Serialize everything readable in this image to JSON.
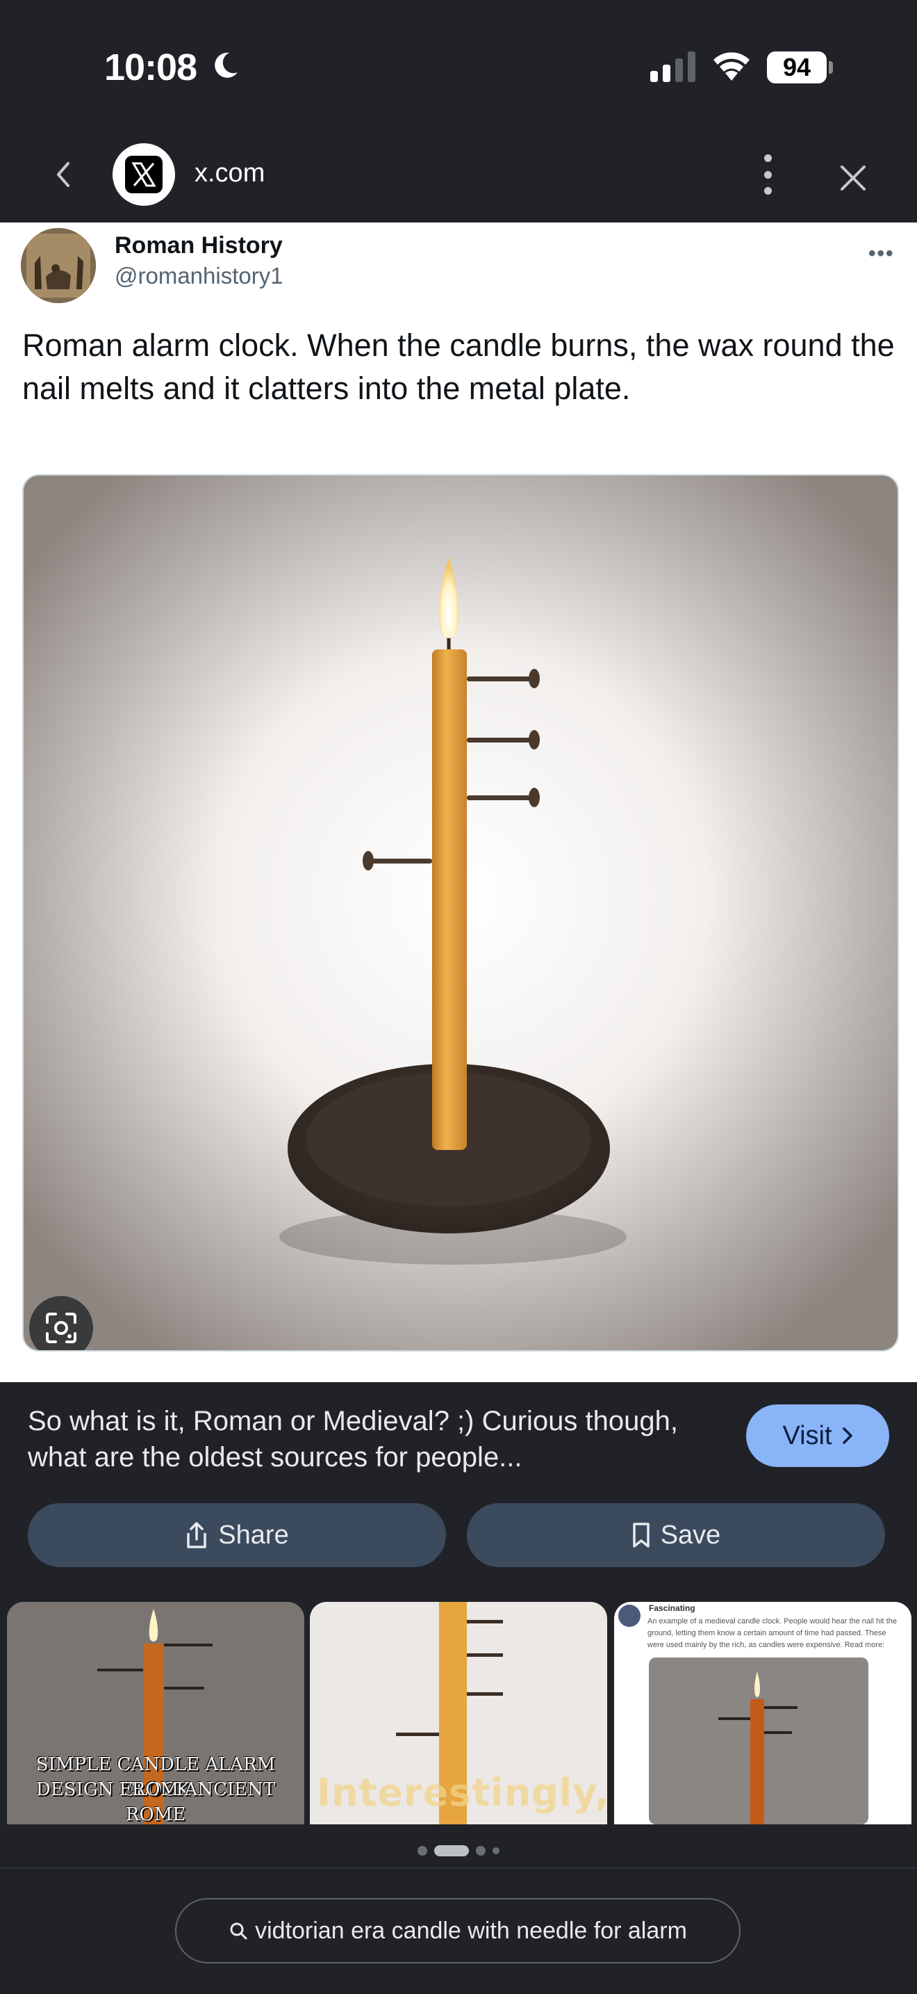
{
  "status_bar": {
    "time": "10:08",
    "battery_level": "94",
    "icons": [
      "moon-icon",
      "cellular-signal-icon",
      "wifi-icon",
      "battery-icon"
    ]
  },
  "browser": {
    "url": "x.com",
    "icons": [
      "back-arrow-icon",
      "x-logo-icon",
      "more-vertical-icon",
      "close-icon"
    ]
  },
  "tweet": {
    "author_name": "Roman History",
    "author_handle": "@romanhistory1",
    "text": "Roman alarm clock. When the candle burns, the wax round the nail melts and it clatters into the metal plate."
  },
  "details": {
    "description": "So what is it, Roman or Medieval? ;) Curious though, what are the oldest sources for people...",
    "visit_label": "Visit",
    "share_label": "Share",
    "save_label": "Save"
  },
  "related": [
    {
      "caption_line1": "SIMPLE CANDLE ALARM CLOCK",
      "caption_line2": "DESIGN FROM ANCIENT ROME"
    },
    {
      "caption": "Interestingly,"
    },
    {
      "author": "Fascinating",
      "text": "An example of a medieval candle clock. People would hear the nail hit the ground, letting them know a certain amount of time had passed. These were used mainly by the rich, as candles were expensive. Read more:"
    }
  ],
  "carousel": {
    "pages": 4,
    "active": 1
  },
  "search": {
    "query": "vidtorian era candle with needle for alarm"
  },
  "colors": {
    "dark_bg": "#202228",
    "visit_button": "#8ab4f8",
    "action_button": "#3c4a5e",
    "candle": "#e6a53e"
  }
}
